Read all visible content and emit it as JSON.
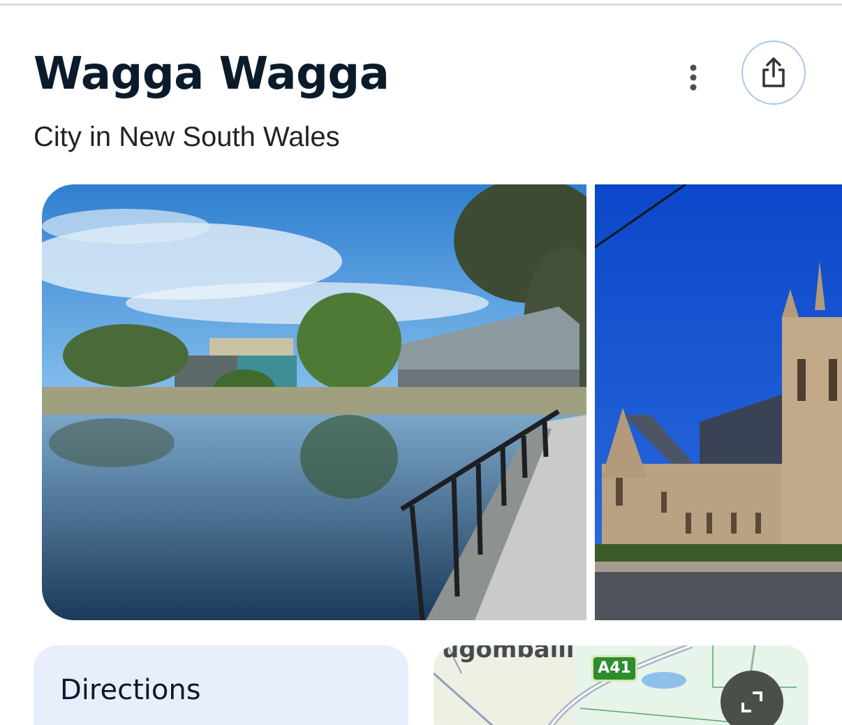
{
  "place": {
    "title": "Wagga Wagga",
    "subtitle": "City in New South Wales"
  },
  "header_actions": {
    "more_icon": "more-vert-icon",
    "share_icon": "share-icon"
  },
  "photos": [
    {
      "subject": "lakeside gallery"
    },
    {
      "subject": "cathedral"
    }
  ],
  "directions": {
    "label": "Directions"
  },
  "map": {
    "place_label": "ugomballi",
    "road_shield": "A41",
    "expand_icon": "expand-icon"
  },
  "colors": {
    "title": "#0b1b2b",
    "accent_ring": "#a9c7ea",
    "directions_bg": "#e8eefc",
    "map_bg": "#e6f4ea",
    "shield": "#2e8b2e"
  }
}
